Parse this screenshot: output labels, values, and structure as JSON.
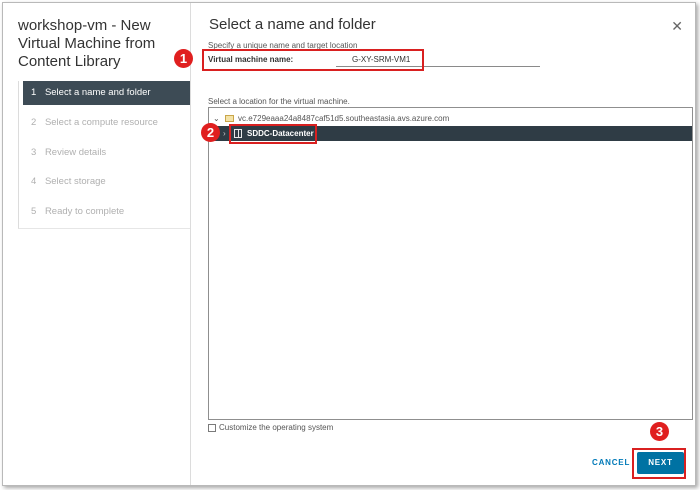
{
  "wizard": {
    "title": "workshop-vm - New Virtual Machine from Content Library",
    "steps": [
      {
        "num": "1",
        "label": "Select a name and folder",
        "active": true
      },
      {
        "num": "2",
        "label": "Select a compute resource",
        "active": false
      },
      {
        "num": "3",
        "label": "Review details",
        "active": false
      },
      {
        "num": "4",
        "label": "Select storage",
        "active": false
      },
      {
        "num": "5",
        "label": "Ready to complete",
        "active": false
      }
    ]
  },
  "page": {
    "title": "Select a name and folder",
    "subtitle": "Specify a unique name and target location",
    "close_icon": "close-icon"
  },
  "vm_name": {
    "label": "Virtual machine name:",
    "value": "G-XY-SRM-VM1"
  },
  "location": {
    "label": "Select a location for the virtual machine.",
    "tree": [
      {
        "label": "vc.e729eaaa24a8487caf51d5.southeastasia.avs.azure.com",
        "icon": "vcenter-icon",
        "expanded": true
      },
      {
        "label": "SDDC-Datacenter",
        "icon": "datacenter-icon",
        "selected": true
      }
    ]
  },
  "customize_os": {
    "label": "Customize the operating system",
    "checked": false
  },
  "footer": {
    "cancel_label": "CANCEL",
    "next_label": "NEXT"
  },
  "annotations": {
    "badge_1": "1",
    "badge_2": "2",
    "badge_3": "3",
    "color": "#e01f1f"
  },
  "colors": {
    "active_step_bg": "#3d4b55",
    "selected_row_bg": "#2f3c45",
    "primary_button": "#0072a3",
    "link": "#0079b8"
  }
}
